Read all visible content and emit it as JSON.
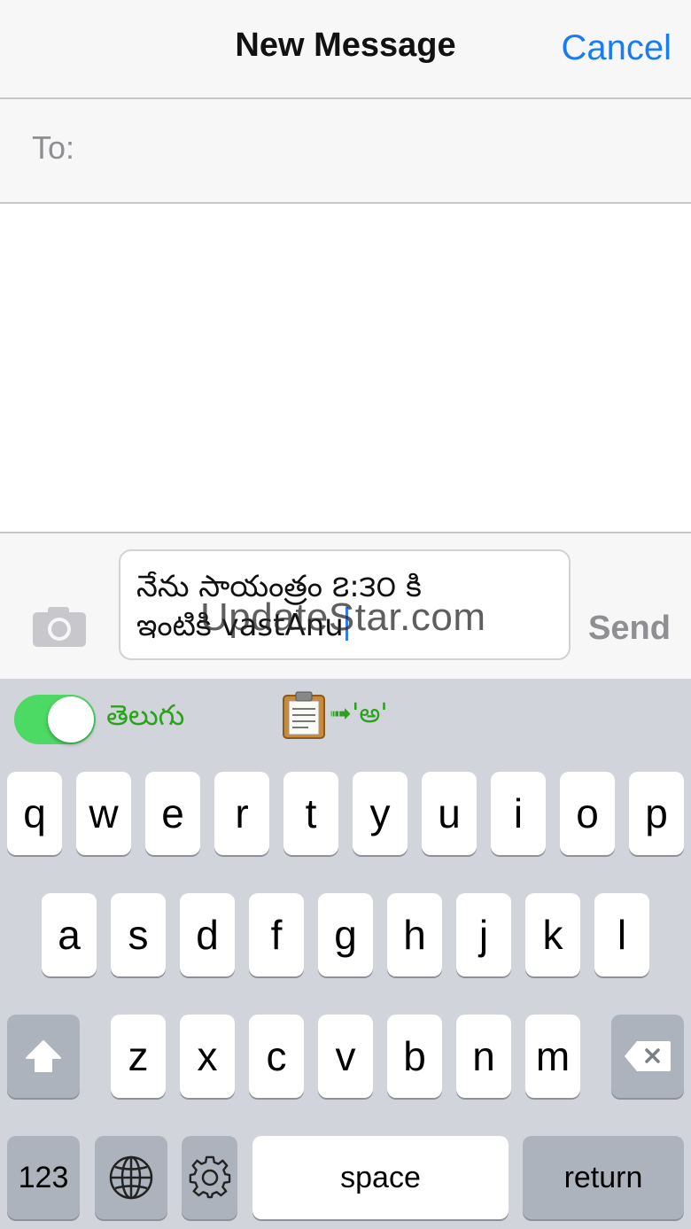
{
  "navbar": {
    "title": "New Message",
    "cancel_label": "Cancel"
  },
  "recipient": {
    "label": "To:"
  },
  "compose": {
    "message_line1": "నేను సాయంత్రం ౭:౩౦ కి",
    "message_line2": "ఇంటికి vastAnu",
    "send_label": "Send"
  },
  "watermark": "UpdateStar.com",
  "keyboard": {
    "toolbar": {
      "language_label": "తెలుగు",
      "toggle_on": true,
      "clipboard_convert_label": "➟'అ'"
    },
    "row1": [
      "q",
      "w",
      "e",
      "r",
      "t",
      "y",
      "u",
      "i",
      "o",
      "p"
    ],
    "row2": [
      "a",
      "s",
      "d",
      "f",
      "g",
      "h",
      "j",
      "k",
      "l"
    ],
    "row3": [
      "z",
      "x",
      "c",
      "v",
      "b",
      "n",
      "m"
    ],
    "numbers_label": "123",
    "space_label": "space",
    "return_label": "return"
  },
  "colors": {
    "accent": "#1a7cf3",
    "toggle": "#4cd964",
    "telugu_green": "#2aa31a"
  },
  "icons": [
    "camera-icon",
    "clipboard-icon",
    "shift-icon",
    "delete-icon",
    "globe-icon",
    "gear-icon"
  ]
}
